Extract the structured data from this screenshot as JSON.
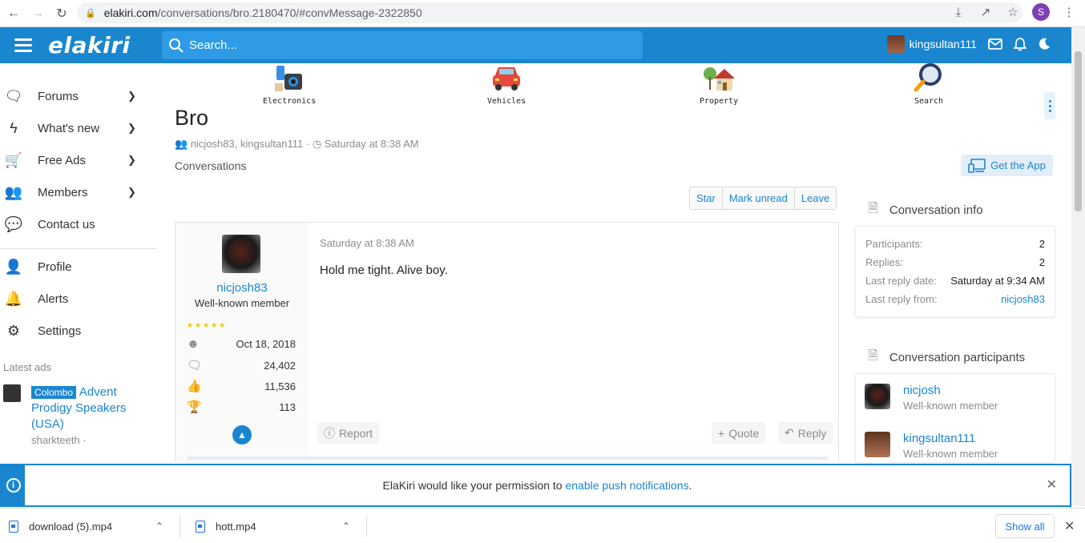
{
  "browser": {
    "url_host": "elakiri.com",
    "url_path": "/conversations/bro.2180470/#convMessage-2322850",
    "profile_initial": "S"
  },
  "header": {
    "logo": "elakiri",
    "search_placeholder": "Search...",
    "username": "kingsultan111"
  },
  "sidebar": {
    "items": [
      {
        "label": "Forums",
        "icon": "chat-bubbles-icon",
        "chevron": "⌄"
      },
      {
        "label": "What's new",
        "icon": "lightning-icon",
        "chevron": "⌄"
      },
      {
        "label": "Free Ads",
        "icon": "cart-icon",
        "chevron": "⌄"
      },
      {
        "label": "Members",
        "icon": "members-icon",
        "chevron": "⌄"
      },
      {
        "label": "Contact us",
        "icon": "contact-icon"
      }
    ],
    "account_items": [
      {
        "label": "Profile",
        "icon": "user-icon"
      },
      {
        "label": "Alerts",
        "icon": "bell-icon"
      },
      {
        "label": "Settings",
        "icon": "gear-icon"
      }
    ],
    "latest_ads_label": "Latest ads",
    "ad": {
      "tag": "Colombo",
      "title": "Advent Prodigy Speakers (USA)",
      "by": "sharkteeth ·"
    }
  },
  "categories": [
    {
      "label": "Electronics",
      "icon": "electronics-icon"
    },
    {
      "label": "Vehicles",
      "icon": "car-icon"
    },
    {
      "label": "Property",
      "icon": "house-icon"
    },
    {
      "label": "Search",
      "icon": "magnifier-icon"
    }
  ],
  "main": {
    "title": "Bro",
    "participants_meta": "nicjosh83, kingsultan111",
    "date_meta": "Saturday at 8:38 AM",
    "breadcrumb": "Conversations",
    "get_app": "Get the App",
    "actions": {
      "star": "Star",
      "mark_unread": "Mark unread",
      "leave": "Leave"
    }
  },
  "message": {
    "username": "nicjosh83",
    "role": "Well-known member",
    "stars": "★★★★★",
    "joined": "Oct 18, 2018",
    "messages": "24,402",
    "reactions": "11,536",
    "points": "113",
    "date": "Saturday at 8:38 AM",
    "text": "Hold me tight. Alive boy.",
    "report": "Report",
    "quote": "Quote",
    "reply": "Reply"
  },
  "conversation_info": {
    "title": "Conversation info",
    "rows": [
      {
        "k": "Participants:",
        "v": "2"
      },
      {
        "k": "Replies:",
        "v": "2"
      },
      {
        "k": "Last reply date:",
        "v": "Saturday at 9:34 AM"
      },
      {
        "k": "Last reply from:",
        "v": "nicjosh83"
      }
    ]
  },
  "participants": {
    "title": "Conversation participants",
    "list": [
      {
        "name": "nicjosh",
        "role": "Well-known member"
      },
      {
        "name": "kingsultan111",
        "role": "Well-known member"
      }
    ]
  },
  "notice": {
    "text_before": "ElaKiri would like your permission to ",
    "link": "enable push notifications",
    "text_after": "."
  },
  "downloads": {
    "files": [
      "download (5).mp4",
      "hott.mp4"
    ],
    "show_all": "Show all"
  },
  "colors": {
    "brand": "#1a86d0",
    "browser_link": "#1a73e8"
  }
}
